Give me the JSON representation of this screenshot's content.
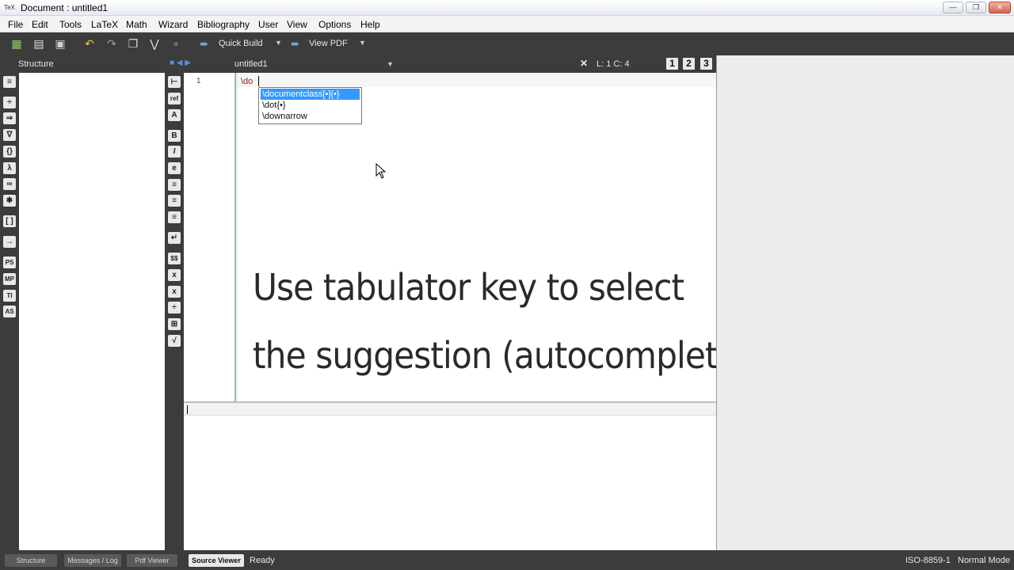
{
  "window": {
    "app_icon": "TeX",
    "title": "Document : untitled1",
    "minimize": "—",
    "maximize": "❐",
    "close": "✕"
  },
  "menu": [
    "File",
    "Edit",
    "Tools",
    "LaTeX",
    "Math",
    "Wizard",
    "Bibliography",
    "User",
    "View",
    "Options",
    "Help"
  ],
  "toolbar": {
    "quick_build": "Quick Build",
    "view_pdf": "View PDF"
  },
  "structure_panel": {
    "title": "Structure"
  },
  "editor": {
    "tab_title": "untitled1",
    "cursor_position": "L: 1 C: 4",
    "view_numbers": [
      "1",
      "2",
      "3"
    ],
    "line_number": "1",
    "text": "\\do"
  },
  "autocomplete": {
    "items": [
      "\\documentclass[•]{•}",
      "\\dot{•}",
      "\\downarrow"
    ],
    "selected_index": 0
  },
  "caption": {
    "line1": "Use tabulator key to select",
    "line2": "the suggestion (autocomplete)"
  },
  "statusbar": {
    "tabs": [
      "Structure",
      "Messages / Log",
      "Pdf Viewer",
      "Source Viewer"
    ],
    "status": "Ready",
    "encoding": "ISO-8859-1",
    "mode": "Normal Mode"
  },
  "icons": {
    "toolbar": [
      "new-file-icon",
      "open-file-icon",
      "save-icon",
      "undo-icon",
      "redo-icon",
      "copy-icon",
      "cut-icon",
      "paste-icon",
      "quick-build-run-icon",
      "view-pdf-run-icon"
    ],
    "left_strip": [
      "list-icon",
      "divide-icon",
      "arrow-right-icon",
      "nabla-icon",
      "braces-icon",
      "lambda-icon",
      "infinity-icon",
      "asterisk-icon",
      "brackets-icon",
      "frac-icon",
      "ps-icon",
      "mp-icon",
      "ti-icon",
      "as-icon"
    ],
    "editor_strip": [
      "label-icon",
      "ref-icon",
      "cite-icon",
      "bold-icon",
      "italic-icon",
      "emph-icon",
      "align-left-icon",
      "align-center-icon",
      "align-right-icon",
      "newline-icon",
      "math-icon",
      "subscript-icon",
      "superscript-icon",
      "fraction-icon",
      "sqrt-icon"
    ]
  },
  "colors": {
    "dark_chrome": "#3c3c3c",
    "selection": "#3399ff",
    "command_text": "#a02020"
  }
}
